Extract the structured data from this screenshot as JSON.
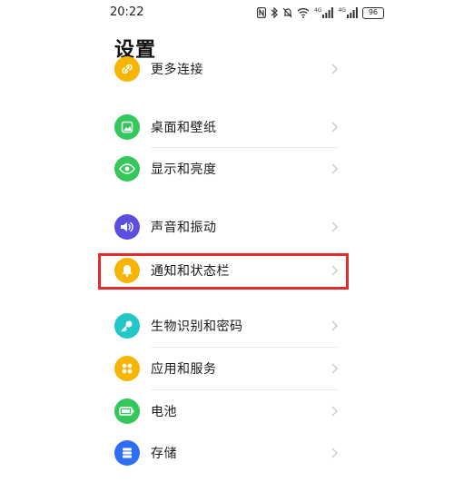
{
  "status_bar": {
    "time": "20:22",
    "battery": "96",
    "network_left": "4G",
    "network_right": "4G"
  },
  "header": {
    "title": "设置"
  },
  "settings": {
    "items": [
      {
        "label": "更多连接",
        "icon": "link-icon",
        "color": "#f7b500"
      },
      {
        "label": "桌面和壁纸",
        "icon": "wallpaper-icon",
        "color": "#34c759"
      },
      {
        "label": "显示和亮度",
        "icon": "eye-icon",
        "color": "#34c759"
      },
      {
        "label": "声音和振动",
        "icon": "speaker-icon",
        "color": "#5b4ee0"
      },
      {
        "label": "通知和状态栏",
        "icon": "bell-icon",
        "color": "#f7b500"
      },
      {
        "label": "生物识别和密码",
        "icon": "key-icon",
        "color": "#22c7c7"
      },
      {
        "label": "应用和服务",
        "icon": "apps-icon",
        "color": "#f7b500"
      },
      {
        "label": "电池",
        "icon": "battery-icon",
        "color": "#34c759"
      },
      {
        "label": "存储",
        "icon": "storage-icon",
        "color": "#2f6df6"
      }
    ]
  },
  "highlight": {
    "color": "#e32b2b"
  }
}
